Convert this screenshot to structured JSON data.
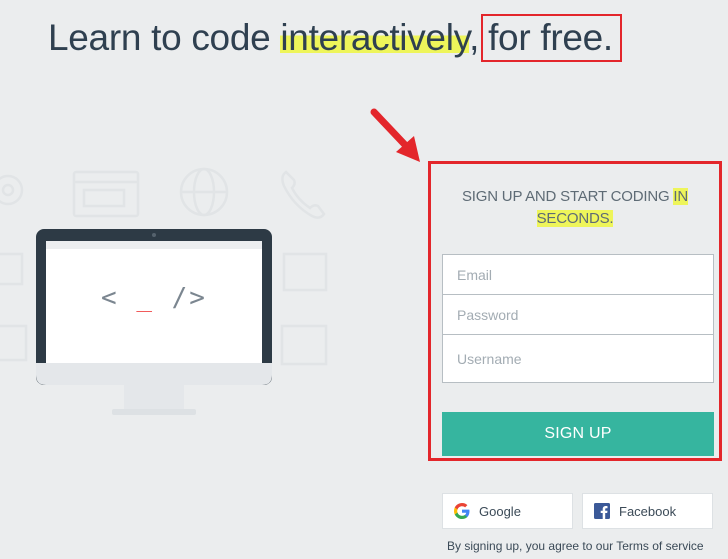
{
  "headline": {
    "part1": "Learn to code ",
    "highlight": "interactively",
    "comma": ",",
    "boxed": "for free."
  },
  "signup_panel": {
    "title_part1": "SIGN UP AND START CODING ",
    "title_highlight_line1": "IN",
    "title_highlight_line2": "SECONDS.",
    "email_placeholder": "Email",
    "password_placeholder": "Password",
    "username_placeholder": "Username",
    "submit_label": "SIGN UP"
  },
  "social": {
    "google_label": "Google",
    "facebook_label": "Facebook"
  },
  "illustration": {
    "code_left": "< ",
    "code_cursor": "_",
    "code_right": " />"
  },
  "footer": {
    "terms_prefix": "By signing up, you agree to our ",
    "terms_link": "Terms of service"
  },
  "colors": {
    "background": "#ebedee",
    "accent_green": "#36b59f",
    "highlight_yellow": "#eef55a",
    "annotation_red": "#e3262b",
    "cursor_red": "#f15b5b"
  },
  "icons": [
    "arrow-annotation-icon",
    "google-icon",
    "facebook-icon",
    "monitor-icon"
  ]
}
